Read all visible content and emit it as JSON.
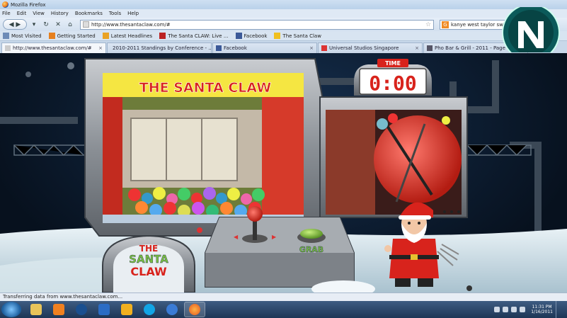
{
  "window": {
    "title": "Mozilla Firefox"
  },
  "menu": [
    "File",
    "Edit",
    "View",
    "History",
    "Bookmarks",
    "Tools",
    "Help"
  ],
  "nav": {
    "url": "http://www.thesantaclaw.com/#",
    "search_value": "kanye west taylor swift"
  },
  "bookmarks": [
    "Most Visited",
    "Getting Started",
    "Latest Headlines",
    "The Santa CLAW: Live ...",
    "Facebook",
    "The Santa Claw"
  ],
  "tabs": [
    {
      "label": "http://www.thesantaclaw.com/#",
      "active": true
    },
    {
      "label": "2010-2011 Standings by Conference - ...",
      "active": false
    },
    {
      "label": "Facebook",
      "active": false
    },
    {
      "label": "Universal Studios Singapore",
      "active": false
    },
    {
      "label": "Pho Bar & Grill - 2011 - Page 7",
      "active": false
    }
  ],
  "game": {
    "timer_label": "TIME",
    "timer_value": "0:00",
    "logo_line1": "THE",
    "logo_line2": "SANTA",
    "logo_line3": "CLAW",
    "banner_text": "THE SANTA CLAW",
    "grab_label": "GRAB"
  },
  "status_text": "Transferring data from www.thesantaclaw.com...",
  "clock": {
    "time": "11:31 PM",
    "date": "1/16/2011"
  },
  "colors": {
    "accent_red": "#d8231c",
    "grab_green": "#7bc043",
    "bg_dark": "#0c1a2a"
  }
}
